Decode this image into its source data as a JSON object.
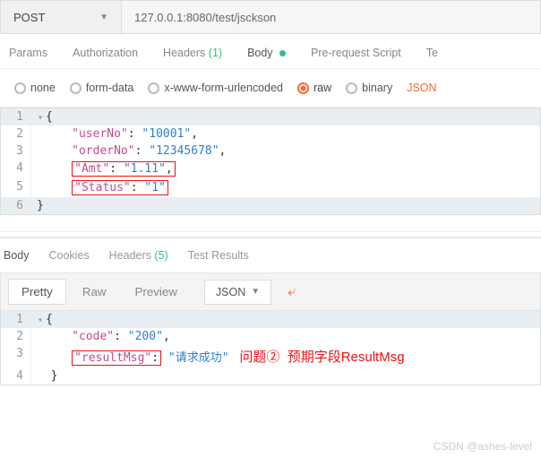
{
  "request": {
    "method": "POST",
    "url": "127.0.0.1:8080/test/jsckson"
  },
  "tabs": {
    "params": "Params",
    "authorization": "Authorization",
    "headers": "Headers",
    "headers_count": "(1)",
    "body": "Body",
    "prerequest": "Pre-request Script",
    "tests": "Te"
  },
  "bodyTypes": {
    "none": "none",
    "formdata": "form-data",
    "urlencoded": "x-www-form-urlencoded",
    "raw": "raw",
    "binary": "binary",
    "json": "JSON"
  },
  "requestBody": {
    "l1": "{",
    "l2_k": "\"userNo\"",
    "l2_v": "\"10001\"",
    "l3_k": "\"orderNo\"",
    "l3_v": "\"12345678\"",
    "l4_k": "\"Amt\"",
    "l4_v": "\"1.11\"",
    "l5_k": "\"Status\"",
    "l5_v": "\"1\"",
    "l6": "}"
  },
  "responseTabs": {
    "body": "Body",
    "cookies": "Cookies",
    "headers": "Headers",
    "headers_count": "(5)",
    "tests": "Test Results"
  },
  "viewModes": {
    "pretty": "Pretty",
    "raw": "Raw",
    "preview": "Preview",
    "lang": "JSON"
  },
  "responseBody": {
    "l1": "{",
    "l2_k": "\"code\"",
    "l2_v": "\"200\"",
    "l3_k": "\"resultMsg\"",
    "l3_v": "\"请求成功\"",
    "l4": "}"
  },
  "annotation": "问题②  预期字段ResultMsg",
  "watermark": "CSDN @ashes-level",
  "gutters": {
    "g1": "1",
    "g2": "2",
    "g3": "3",
    "g4": "4",
    "g5": "5",
    "g6": "6"
  },
  "rg": {
    "g1": "1",
    "g2": "2",
    "g3": "3",
    "g4": "4"
  }
}
